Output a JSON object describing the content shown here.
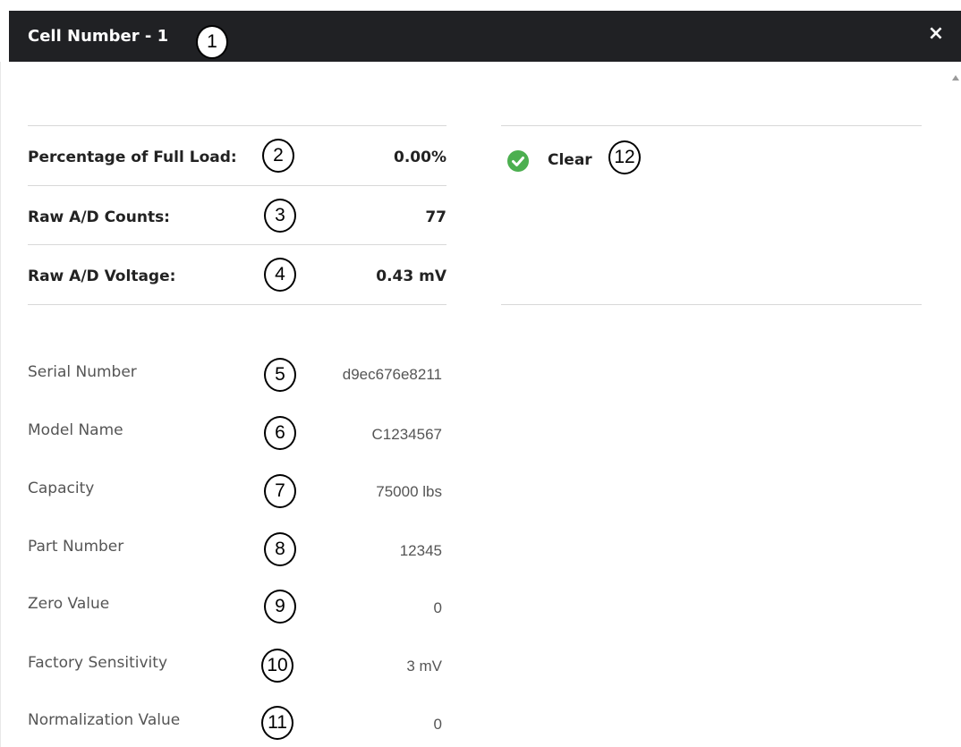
{
  "window": {
    "title": "Cell Number - 1",
    "close_label": "×"
  },
  "badges": {
    "b1": "1",
    "b2": "2",
    "b3": "3",
    "b4": "4",
    "b5": "5",
    "b6": "6",
    "b7": "7",
    "b8": "8",
    "b9": "9",
    "b10": "10",
    "b11": "11",
    "b12": "12"
  },
  "readings": {
    "percent_full_load": {
      "label": "Percentage of Full Load:",
      "value": "0.00%"
    },
    "raw_ad_counts": {
      "label": "Raw A/D Counts:",
      "value": "77"
    },
    "raw_ad_voltage": {
      "label": "Raw A/D Voltage:",
      "value": "0.43 mV"
    }
  },
  "status": {
    "icon": "check-circle-icon",
    "color": "#4caf50",
    "label": "Clear"
  },
  "details": {
    "serial_number": {
      "label": "Serial Number",
      "value": "d9ec676e8211"
    },
    "model_name": {
      "label": "Model Name",
      "value": "C1234567"
    },
    "capacity": {
      "label": "Capacity",
      "value": "75000 lbs"
    },
    "part_number": {
      "label": "Part Number",
      "value": "12345"
    },
    "zero_value": {
      "label": "Zero Value",
      "value": "0"
    },
    "factory_sensitivity": {
      "label": "Factory Sensitivity",
      "value": "3 mV"
    },
    "normalization_value": {
      "label": "Normalization Value",
      "value": "0"
    }
  },
  "colors": {
    "titlebar": "#202124",
    "divider": "#d8d8d8"
  }
}
